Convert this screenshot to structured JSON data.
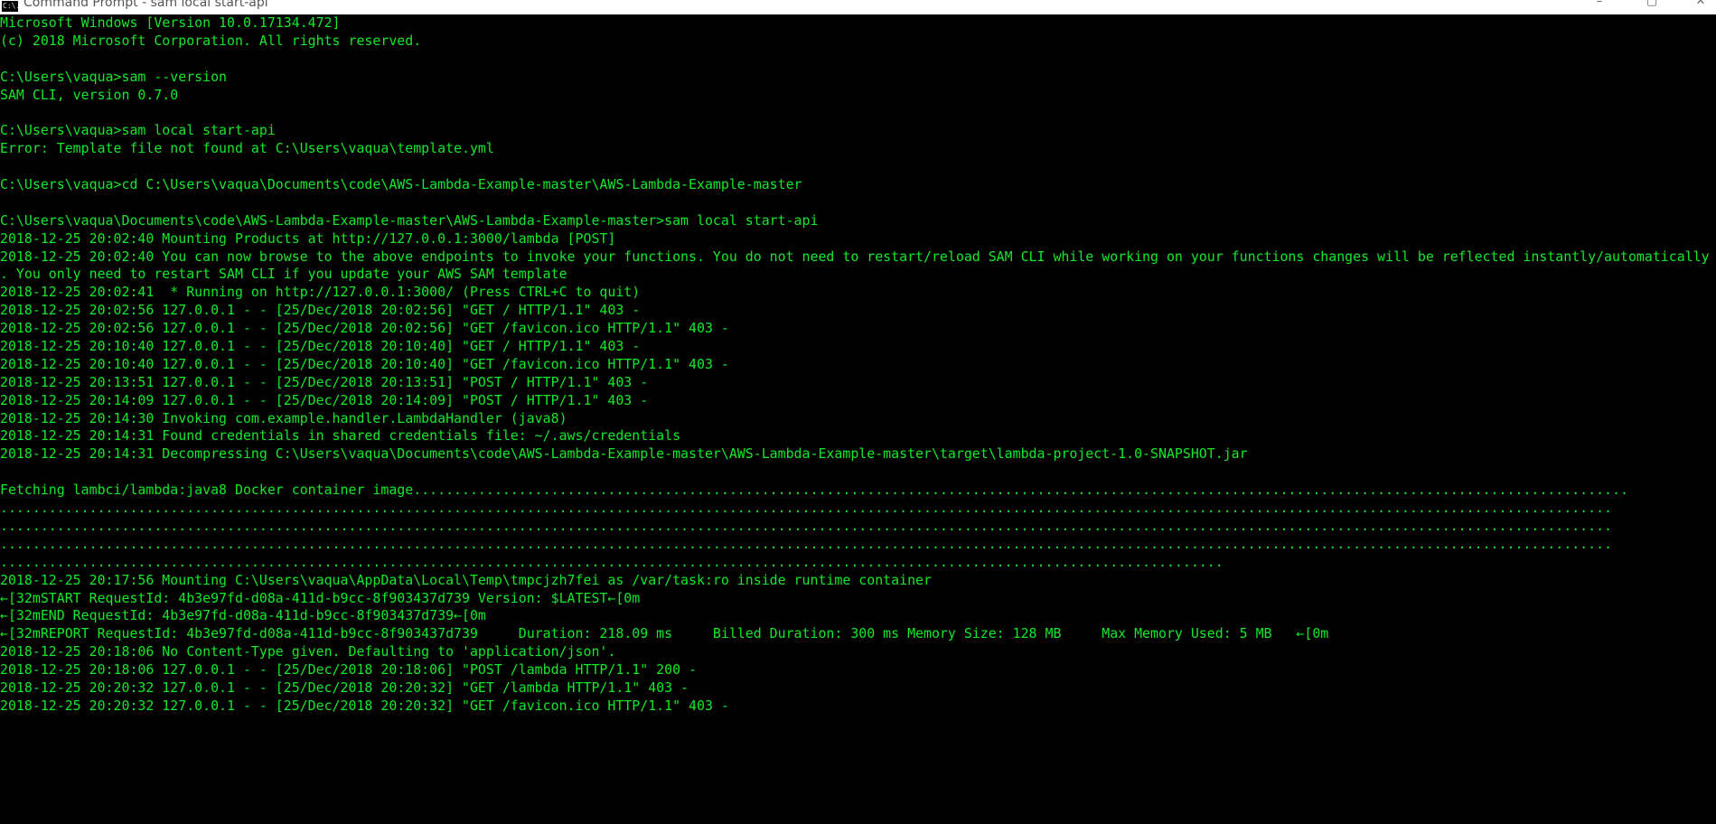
{
  "window": {
    "title": "Command Prompt - sam  local start-api",
    "icon_label": "C:\\.",
    "icon_name": "cmd-icon",
    "controls": {
      "minimize": "–",
      "maximize": "▢",
      "close": "✕"
    }
  },
  "colors": {
    "background": "#000000",
    "text": "#13e829"
  },
  "console": {
    "lines": [
      "Microsoft Windows [Version 10.0.17134.472]",
      "(c) 2018 Microsoft Corporation. All rights reserved.",
      "",
      "C:\\Users\\vaqua>sam --version",
      "SAM CLI, version 0.7.0",
      "",
      "C:\\Users\\vaqua>sam local start-api",
      "Error: Template file not found at C:\\Users\\vaqua\\template.yml",
      "",
      "C:\\Users\\vaqua>cd C:\\Users\\vaqua\\Documents\\code\\AWS-Lambda-Example-master\\AWS-Lambda-Example-master",
      "",
      "C:\\Users\\vaqua\\Documents\\code\\AWS-Lambda-Example-master\\AWS-Lambda-Example-master>sam local start-api",
      "2018-12-25 20:02:40 Mounting Products at http://127.0.0.1:3000/lambda [POST]",
      "2018-12-25 20:02:40 You can now browse to the above endpoints to invoke your functions. You do not need to restart/reload SAM CLI while working on your functions changes will be reflected instantly/automatically",
      ". You only need to restart SAM CLI if you update your AWS SAM template",
      "2018-12-25 20:02:41  * Running on http://127.0.0.1:3000/ (Press CTRL+C to quit)",
      "2018-12-25 20:02:56 127.0.0.1 - - [25/Dec/2018 20:02:56] \"GET / HTTP/1.1\" 403 -",
      "2018-12-25 20:02:56 127.0.0.1 - - [25/Dec/2018 20:02:56] \"GET /favicon.ico HTTP/1.1\" 403 -",
      "2018-12-25 20:10:40 127.0.0.1 - - [25/Dec/2018 20:10:40] \"GET / HTTP/1.1\" 403 -",
      "2018-12-25 20:10:40 127.0.0.1 - - [25/Dec/2018 20:10:40] \"GET /favicon.ico HTTP/1.1\" 403 -",
      "2018-12-25 20:13:51 127.0.0.1 - - [25/Dec/2018 20:13:51] \"POST / HTTP/1.1\" 403 -",
      "2018-12-25 20:14:09 127.0.0.1 - - [25/Dec/2018 20:14:09] \"POST / HTTP/1.1\" 403 -",
      "2018-12-25 20:14:30 Invoking com.example.handler.LambdaHandler (java8)",
      "2018-12-25 20:14:31 Found credentials in shared credentials file: ~/.aws/credentials",
      "2018-12-25 20:14:31 Decompressing C:\\Users\\vaqua\\Documents\\code\\AWS-Lambda-Example-master\\AWS-Lambda-Example-master\\target\\lambda-project-1.0-SNAPSHOT.jar",
      "",
      "Fetching lambci/lambda:java8 Docker container image......................................................................................................................................................",
      ".......................................................................................................................................................................................................",
      ".......................................................................................................................................................................................................",
      ".......................................................................................................................................................................................................",
      ".......................................................................................................................................................",
      "2018-12-25 20:17:56 Mounting C:\\Users\\vaqua\\AppData\\Local\\Temp\\tmpcjzh7fei as /var/task:ro inside runtime container",
      "←[32mSTART RequestId: 4b3e97fd-d08a-411d-b9cc-8f903437d739 Version: $LATEST←[0m",
      "←[32mEND RequestId: 4b3e97fd-d08a-411d-b9cc-8f903437d739←[0m",
      "←[32mREPORT RequestId: 4b3e97fd-d08a-411d-b9cc-8f903437d739     Duration: 218.09 ms     Billed Duration: 300 ms Memory Size: 128 MB     Max Memory Used: 5 MB   ←[0m",
      "2018-12-25 20:18:06 No Content-Type given. Defaulting to 'application/json'.",
      "2018-12-25 20:18:06 127.0.0.1 - - [25/Dec/2018 20:18:06] \"POST /lambda HTTP/1.1\" 200 -",
      "2018-12-25 20:20:32 127.0.0.1 - - [25/Dec/2018 20:20:32] \"GET /lambda HTTP/1.1\" 403 -",
      "2018-12-25 20:20:32 127.0.0.1 - - [25/Dec/2018 20:20:32] \"GET /favicon.ico HTTP/1.1\" 403 -"
    ]
  }
}
